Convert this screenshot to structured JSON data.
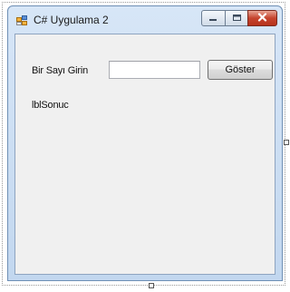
{
  "window": {
    "title": "C# Uygulama 2",
    "icon": "winforms-form-icon",
    "caption_buttons": {
      "minimize": "minimize-icon",
      "maximize": "maximize-icon",
      "close": "close-icon"
    },
    "colors": {
      "titlebar": "#c9dcf2",
      "client_background": "#f0f0f0",
      "close_button": "#c6442e"
    }
  },
  "form": {
    "prompt_label": "Bir Sayı Girin",
    "input": {
      "value": "",
      "placeholder": ""
    },
    "show_button_label": "Göster",
    "result_label": "lblSonuc"
  }
}
